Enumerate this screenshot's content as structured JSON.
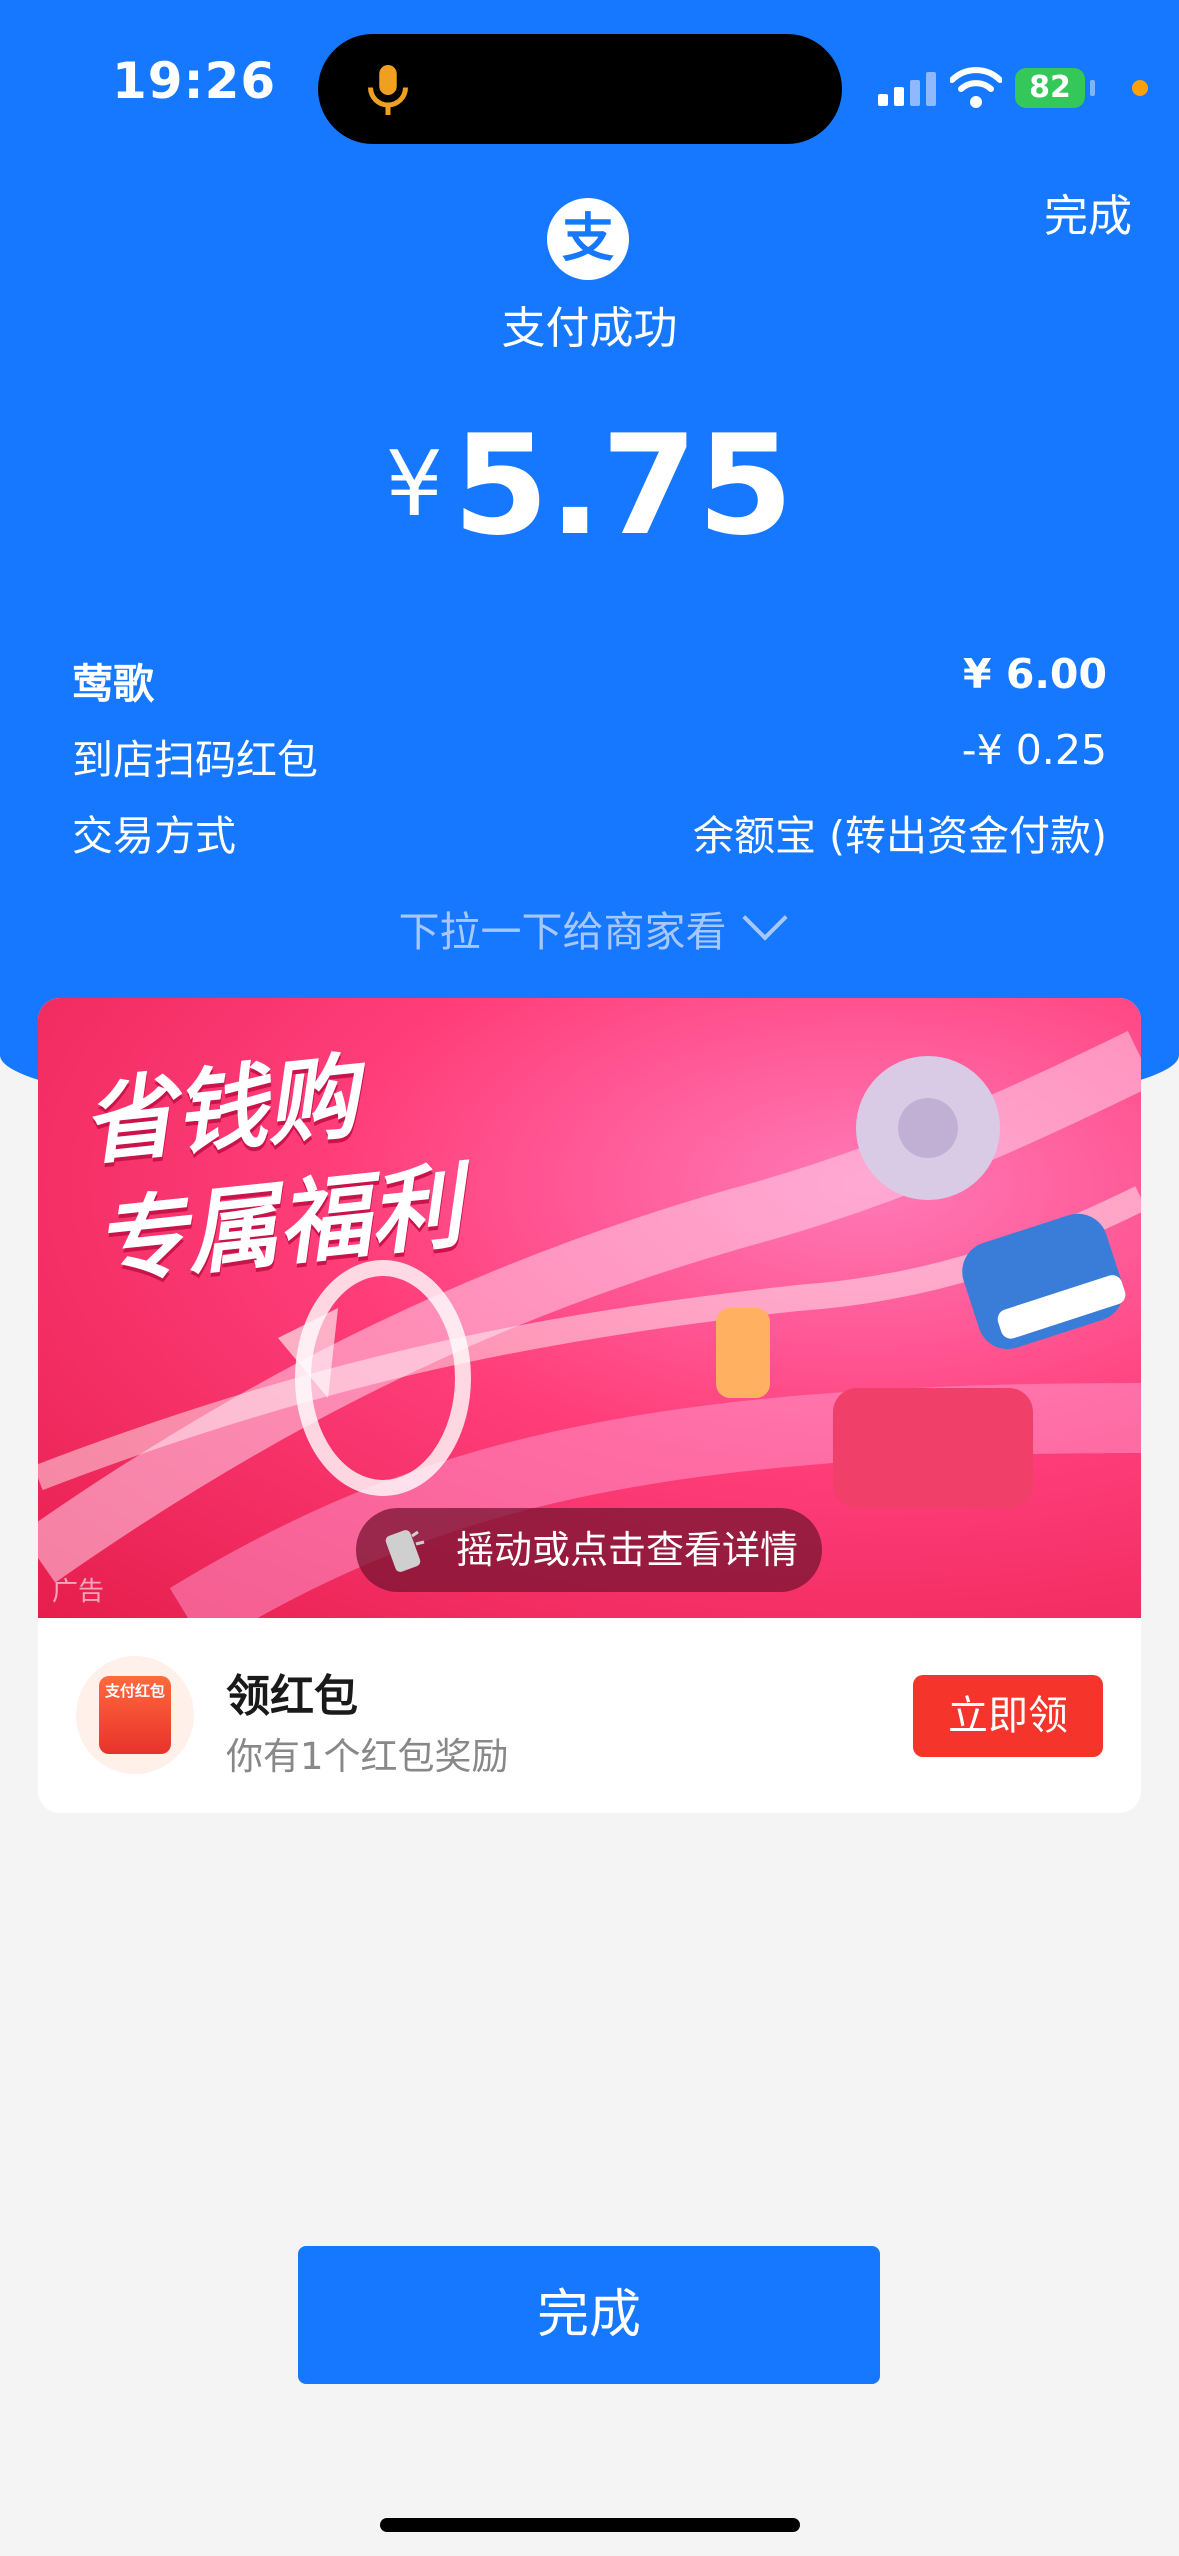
{
  "status_bar": {
    "time": "19:26",
    "battery": "82"
  },
  "header": {
    "done_label": "完成",
    "logo_char": "支",
    "success_text": "支付成功"
  },
  "amount": {
    "currency": "¥",
    "value": "5.75"
  },
  "details": [
    {
      "label": "莺歌",
      "value": "¥ 6.00"
    },
    {
      "label": "到店扫码红包",
      "value": "-¥ 0.25"
    },
    {
      "label": "交易方式",
      "value": "余额宝 (转出资金付款)"
    }
  ],
  "pull_hint": "下拉一下给商家看",
  "banner": {
    "title_line1": "省钱购",
    "title_line2": "专属福利",
    "ad_label": "广告",
    "shake_text": "摇动或点击查看详情"
  },
  "reward": {
    "icon_text": "支付红包",
    "title": "领红包",
    "subtitle": "你有1个红包奖励",
    "button_label": "立即领"
  },
  "bottom_button": "完成",
  "colors": {
    "primary": "#1677ff",
    "claim_red": "#f5342b",
    "battery_green": "#34c759"
  }
}
